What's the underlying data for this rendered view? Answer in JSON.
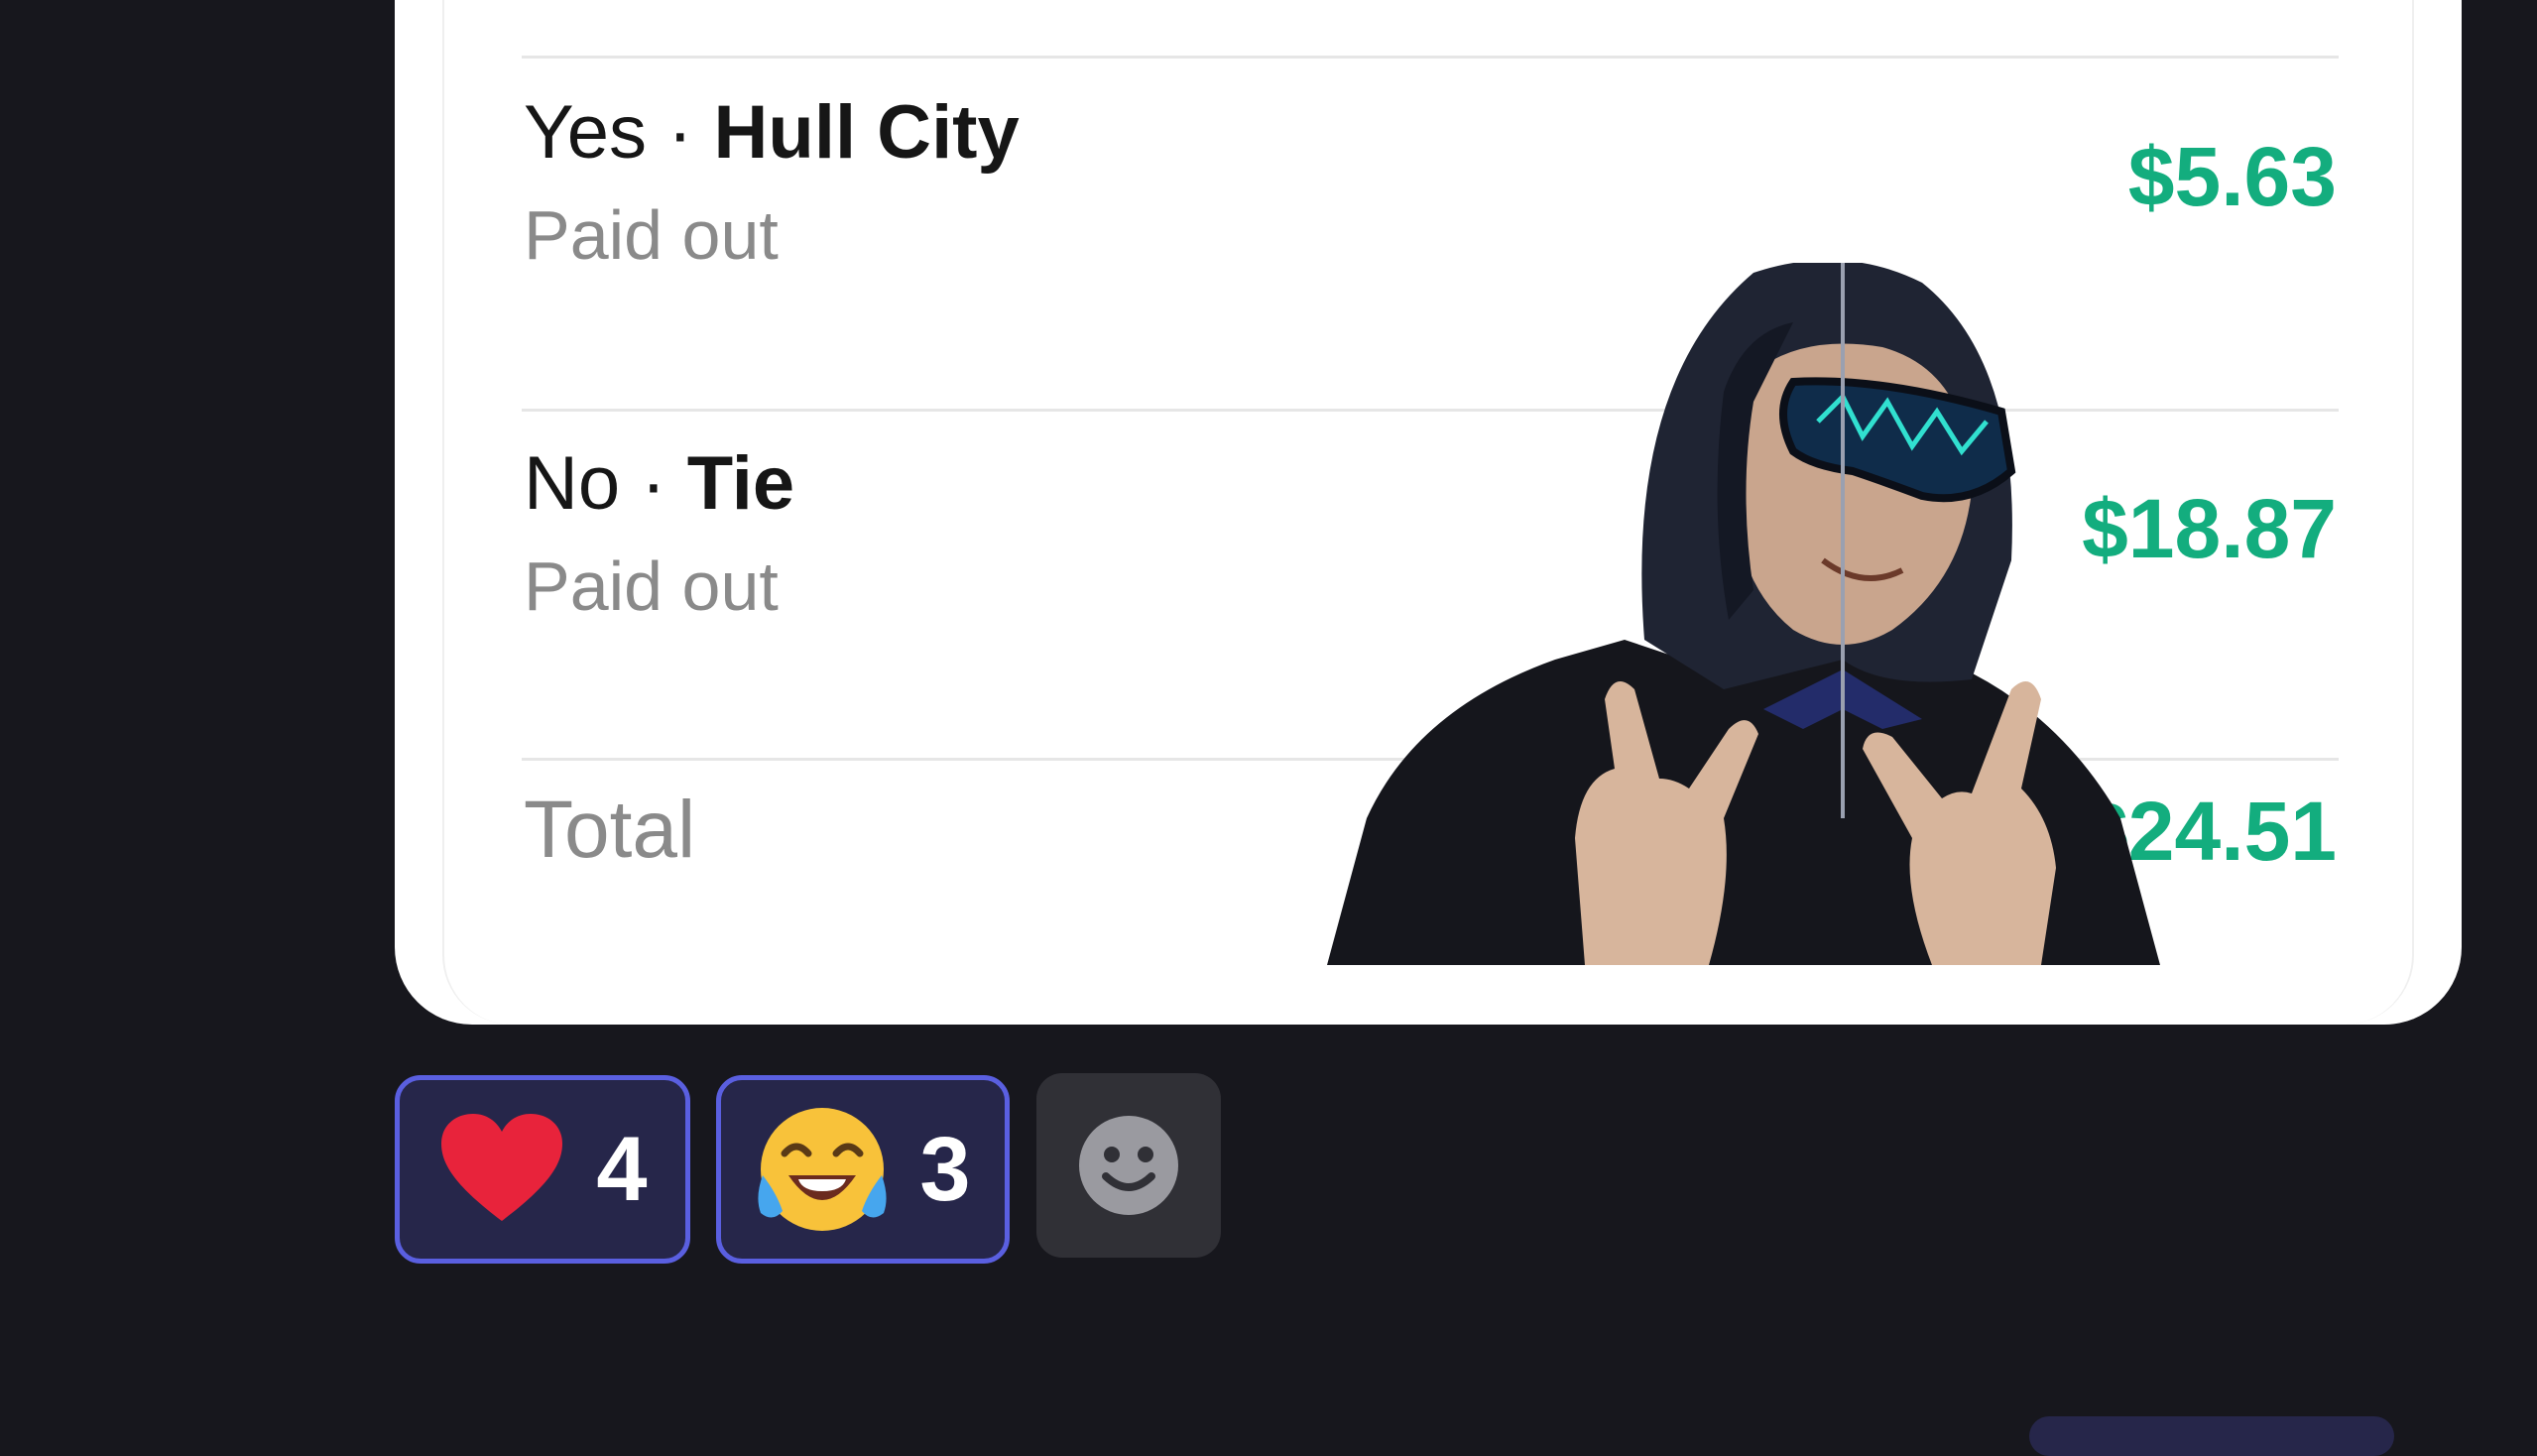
{
  "bets": [
    {
      "side": "Yes",
      "separator": " · ",
      "outcome": "Hull City",
      "status": "Paid out",
      "amount": "$5.63"
    },
    {
      "side": "No",
      "separator": " · ",
      "outcome": "Tie",
      "status": "Paid out",
      "amount": "$18.87"
    }
  ],
  "total": {
    "label": "Total",
    "amount": "$24.51"
  },
  "reactions": [
    {
      "emoji": "heart",
      "count": "4"
    },
    {
      "emoji": "tears-of-joy",
      "count": "3"
    }
  ],
  "add_reaction_icon": "smiley-add-icon",
  "colors": {
    "background": "#17171d",
    "card": "#ffffff",
    "amount": "#13ad7e",
    "reaction_active_bg": "#26264a",
    "reaction_active_border": "#5a5fe0"
  }
}
